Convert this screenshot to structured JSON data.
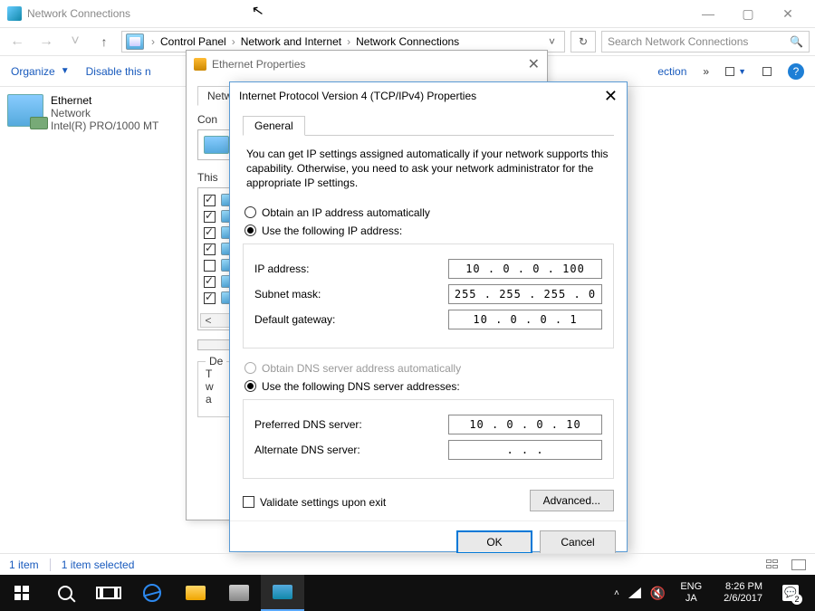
{
  "window": {
    "title": "Network Connections",
    "minimize": "—",
    "maximize": "▢",
    "close": "✕"
  },
  "breadcrumb": {
    "root_glyph": "›",
    "items": [
      "Control Panel",
      "Network and Internet",
      "Network Connections"
    ],
    "dropdown": "˅",
    "refresh": "↻"
  },
  "search": {
    "placeholder": "Search Network Connections",
    "icon": "🔍"
  },
  "toolbar": {
    "organize": "Organize",
    "disable": "Disable this n",
    "ection": "ection",
    "more": "»"
  },
  "adapter": {
    "name": "Ethernet",
    "status": "Network",
    "device": "Intel(R) PRO/1000 MT"
  },
  "ethProps": {
    "title": "Ethernet Properties",
    "tab": "Netwo",
    "connect_label": "Con",
    "items_label": "This",
    "items": [
      {
        "checked": true
      },
      {
        "checked": true
      },
      {
        "checked": true
      },
      {
        "checked": true
      },
      {
        "checked": false
      },
      {
        "checked": true
      },
      {
        "checked": true
      }
    ],
    "scroll_left": "<",
    "scroll_right": ">",
    "desc_label": "De",
    "desc_lines": [
      "T",
      "w",
      "a"
    ]
  },
  "ipv4": {
    "title": "Internet Protocol Version 4 (TCP/IPv4) Properties",
    "tab": "General",
    "intro": "You can get IP settings assigned automatically if your network supports this capability. Otherwise, you need to ask your network administrator for the appropriate IP settings.",
    "radio_auto_ip": "Obtain an IP address automatically",
    "radio_manual_ip": "Use the following IP address:",
    "labels": {
      "ip": "IP address:",
      "mask": "Subnet mask:",
      "gateway": "Default gateway:",
      "pref_dns": "Preferred DNS server:",
      "alt_dns": "Alternate DNS server:"
    },
    "values": {
      "ip": "10 .  0  .  0  . 100",
      "mask": "255 . 255 . 255 .  0",
      "gateway": "10 .  0  .  0  .  1",
      "pref_dns": "10 .  0  .  0  . 10",
      "alt_dns": ".     .     ."
    },
    "radio_auto_dns": "Obtain DNS server address automatically",
    "radio_manual_dns": "Use the following DNS server addresses:",
    "validate": "Validate settings upon exit",
    "advanced": "Advanced...",
    "ok": "OK",
    "cancel": "Cancel"
  },
  "statusbar": {
    "count": "1 item",
    "selected": "1 item selected"
  },
  "taskbar": {
    "lang1": "ENG",
    "lang2": "JA",
    "time": "8:26 PM",
    "date": "2/6/2017",
    "tray_up": "˄"
  }
}
